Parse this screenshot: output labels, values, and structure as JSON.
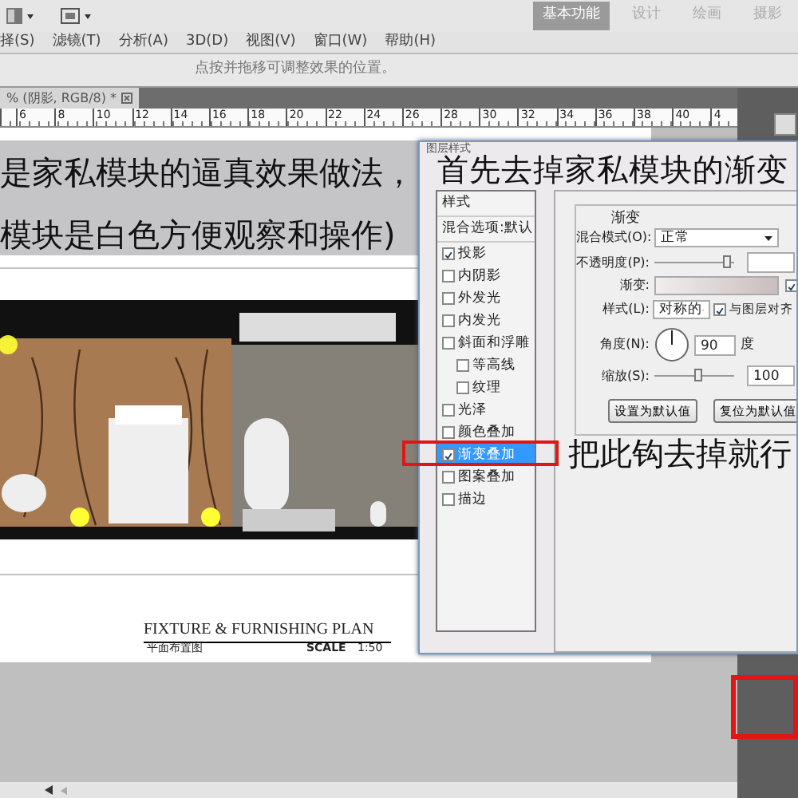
{
  "workspace_switcher": [
    {
      "label": "基本功能",
      "selected": true
    },
    {
      "label": "设计",
      "selected": false
    },
    {
      "label": "绘画",
      "selected": false
    },
    {
      "label": "摄影",
      "selected": false
    }
  ],
  "menu": [
    "择(S)",
    "滤镜(T)",
    "分析(A)",
    "3D(D)",
    "视图(V)",
    "窗口(W)",
    "帮助(H)"
  ],
  "options_bar": {
    "hint": "点按并拖移可调整效果的位置。"
  },
  "document_tab": {
    "title": "% (阴影, RGB/8) *"
  },
  "ruler": {
    "ticks": [
      "6",
      "8",
      "10",
      "12",
      "14",
      "16",
      "18",
      "20",
      "22",
      "24",
      "26",
      "28",
      "30",
      "32",
      "34",
      "36",
      "38",
      "40",
      "4"
    ]
  },
  "plan": {
    "title": "FIXTURE  &  FURNISHING  PLAN",
    "subtitle": "平面布置图",
    "scale_label": "SCALE",
    "scale": "1:50"
  },
  "dialog": {
    "title": "图层样式",
    "styles_header": "样式",
    "blend_default": "混合选项:默认",
    "effects": [
      {
        "label": "投影",
        "checked": true,
        "selected": false
      },
      {
        "label": "内阴影",
        "checked": false,
        "selected": false
      },
      {
        "label": "外发光",
        "checked": false,
        "selected": false
      },
      {
        "label": "内发光",
        "checked": false,
        "selected": false
      },
      {
        "label": "斜面和浮雕",
        "checked": false,
        "selected": false,
        "children": [
          {
            "label": "等高线",
            "checked": false,
            "selected": false
          },
          {
            "label": "纹理",
            "checked": false,
            "selected": false
          }
        ]
      },
      {
        "label": "光泽",
        "checked": false,
        "selected": false
      },
      {
        "label": "颜色叠加",
        "checked": false,
        "selected": false
      },
      {
        "label": "渐变叠加",
        "checked": true,
        "selected": true
      },
      {
        "label": "图案叠加",
        "checked": false,
        "selected": false
      },
      {
        "label": "描边",
        "checked": false,
        "selected": false
      }
    ],
    "group_title": "渐变",
    "blend_mode": {
      "label": "混合模式(O):",
      "value": "正常"
    },
    "opacity": {
      "label": "不透明度(P):",
      "level": 0.95
    },
    "gradient": {
      "label": "渐变:",
      "reverse_checked": true
    },
    "style": {
      "label": "样式(L):",
      "value": "对称的",
      "align_label": "与图层对齐",
      "align_checked": true
    },
    "angle": {
      "label": "角度(N):",
      "value": "90",
      "unit": "度"
    },
    "scale": {
      "label": "缩放(S):",
      "level": 0.55,
      "value": "100"
    },
    "buttons": [
      "设置为默认值",
      "复位为默认值"
    ]
  },
  "captions": {
    "line_1": "是家私模块的逼真效果做法，",
    "line_2": "模块是白色方便观察和操作)",
    "line_3": "首先去掉家私模块的渐变",
    "note": "把此钩去掉就行"
  }
}
